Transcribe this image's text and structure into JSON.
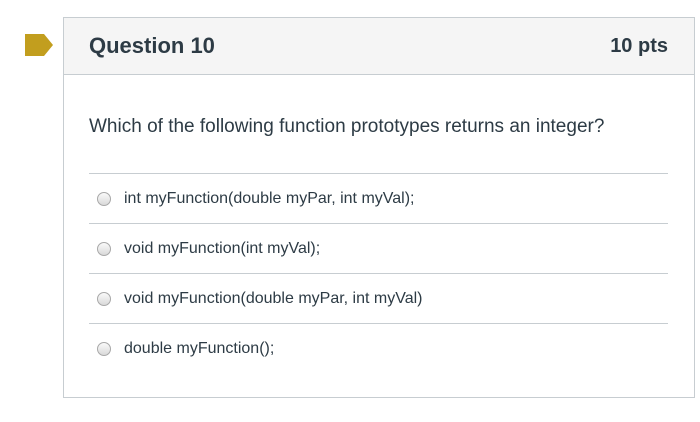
{
  "question": {
    "title": "Question 10",
    "points": "10 pts",
    "text": "Which of the following function prototypes returns an integer?",
    "flag_color": "#c29e1e",
    "answers": [
      {
        "label": "int myFunction(double myPar, int myVal);"
      },
      {
        "label": "void myFunction(int myVal);"
      },
      {
        "label": "void myFunction(double myPar, int myVal)"
      },
      {
        "label": "double myFunction();"
      }
    ]
  }
}
